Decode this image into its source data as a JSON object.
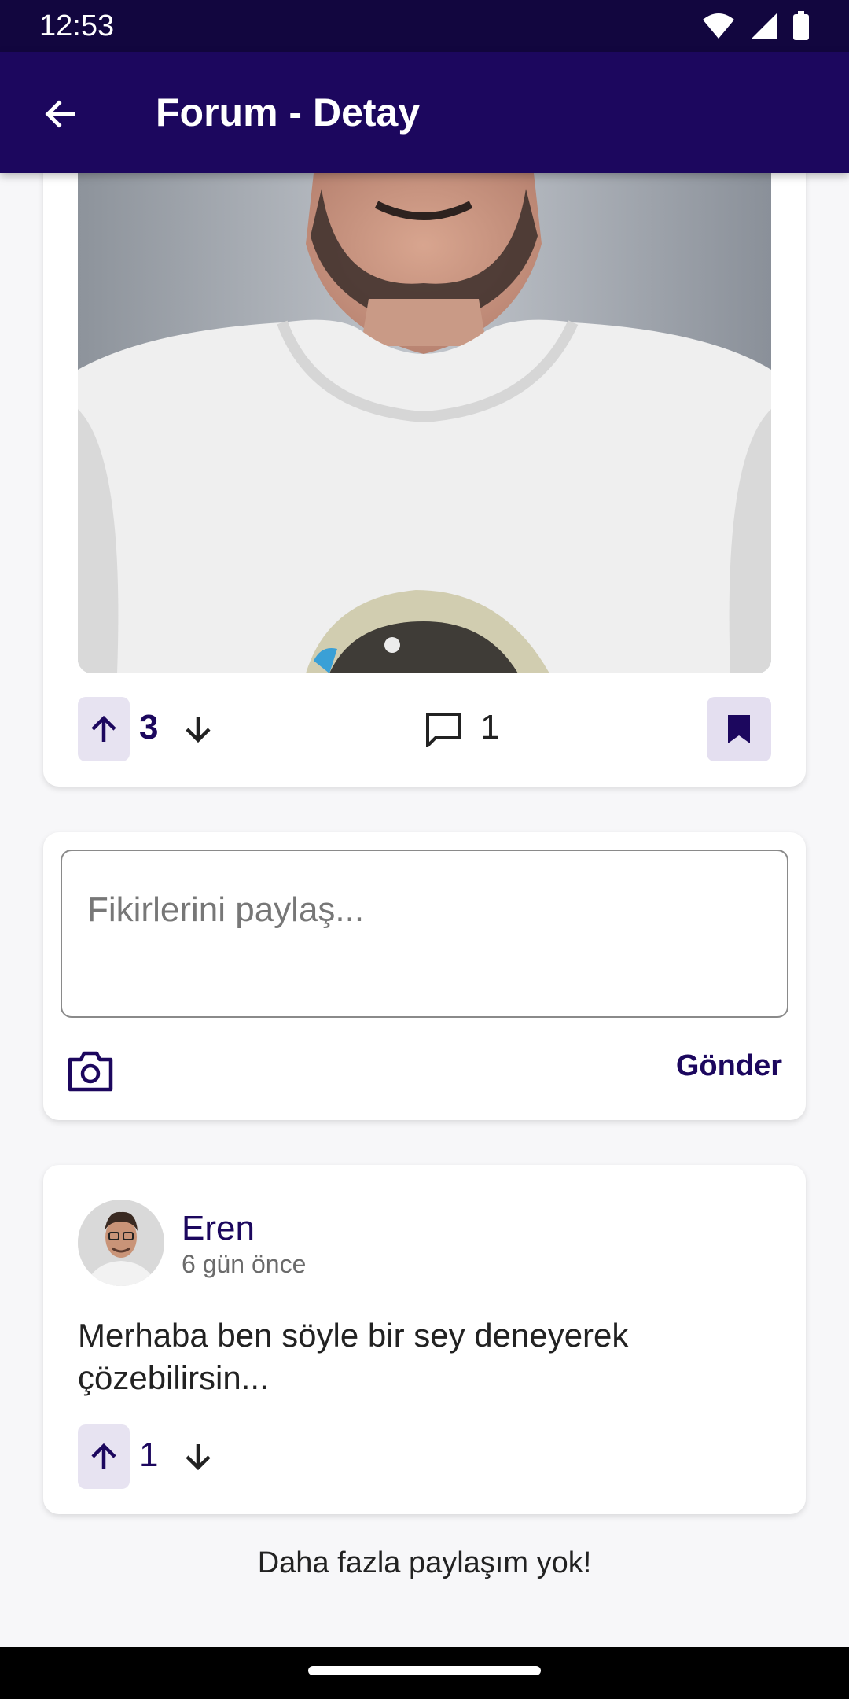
{
  "status_bar": {
    "time": "12:53"
  },
  "app_bar": {
    "title": "Forum - Detay"
  },
  "post": {
    "upvotes": "3",
    "comment_count": "1",
    "accent": "#1c075e"
  },
  "compose": {
    "placeholder": "Fikirlerini paylaş...",
    "send_label": "Gönder"
  },
  "comment": {
    "author": "Eren",
    "time_ago": "6 gün önce",
    "text": "Merhaba ben söyle bir sey deneyerek çözebilirsin...",
    "upvotes": "1"
  },
  "footer": {
    "end_message": "Daha fazla paylaşım yok!"
  },
  "icons": [
    "wifi-icon",
    "signal-icon",
    "battery-icon",
    "arrow-back-icon",
    "arrow-up-icon",
    "arrow-down-icon",
    "comment-icon",
    "bookmark-icon",
    "camera-icon"
  ]
}
